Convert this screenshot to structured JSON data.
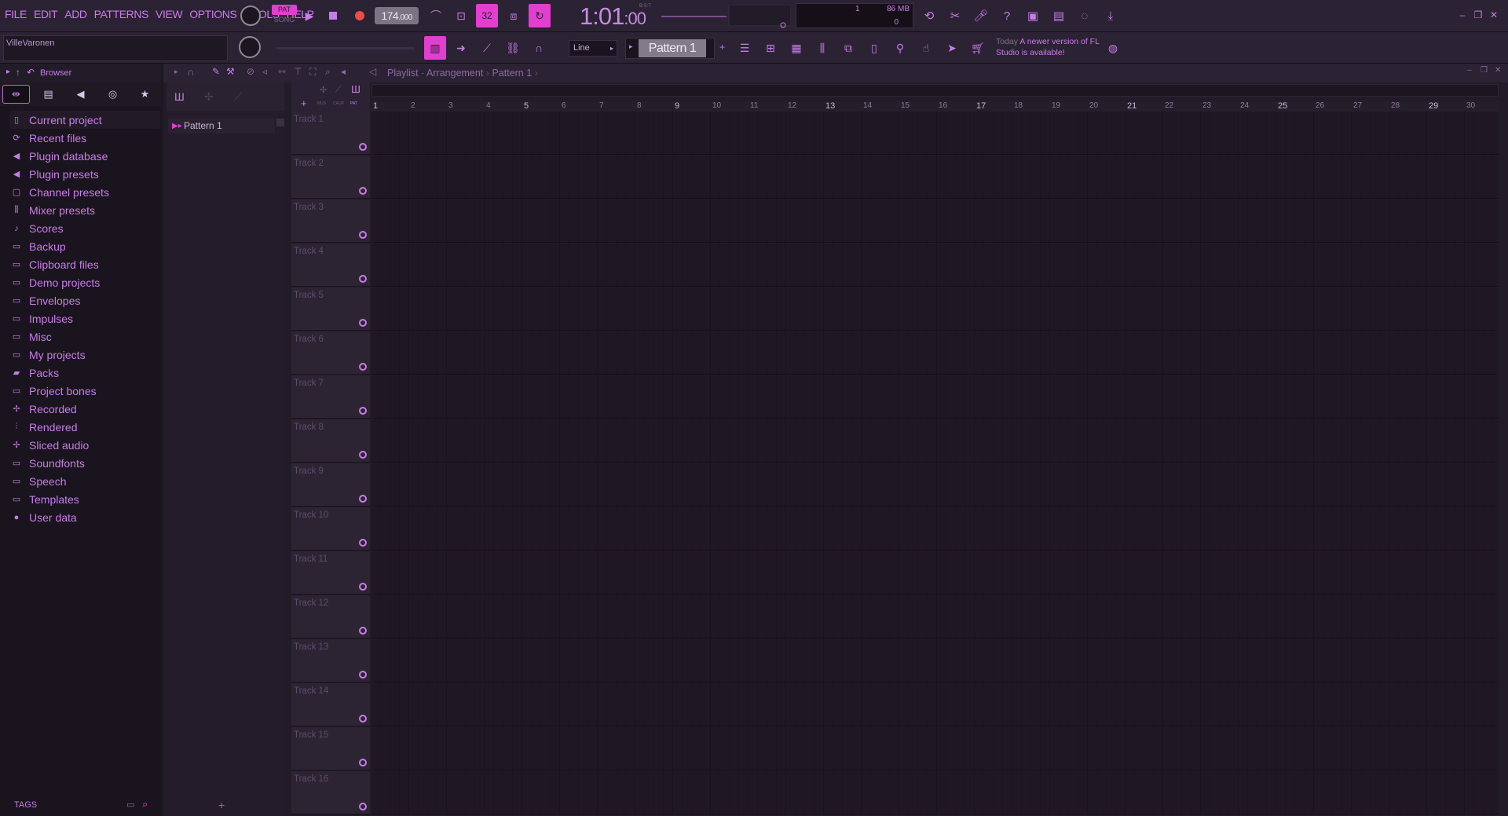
{
  "menu": [
    "FILE",
    "EDIT",
    "ADD",
    "PATTERNS",
    "VIEW",
    "OPTIONS",
    "TOOLS",
    "HELP"
  ],
  "transport": {
    "pat_label": "PAT",
    "song_label": "SONG",
    "tempo": "174",
    "tempo_decimal": ".000",
    "time_main": "1:01",
    "time_small": ":00",
    "time_sub": "B:S:T",
    "step": "32"
  },
  "monitor": {
    "memory": "86 MB",
    "polyphony": "1",
    "cpu": "0"
  },
  "toolbar2": {
    "user": "VilleVaronen",
    "snap": "Line",
    "pattern": "Pattern 1",
    "hint_today": "Today",
    "hint_text": "A newer version of FL Studio is available!"
  },
  "browser": {
    "title": "Browser",
    "items": [
      {
        "label": "Current project",
        "icon": "project-icon"
      },
      {
        "label": "Recent files",
        "icon": "recent-icon"
      },
      {
        "label": "Plugin database",
        "icon": "plugin-icon"
      },
      {
        "label": "Plugin presets",
        "icon": "plugin-icon"
      },
      {
        "label": "Channel presets",
        "icon": "channel-icon"
      },
      {
        "label": "Mixer presets",
        "icon": "mixer-icon"
      },
      {
        "label": "Scores",
        "icon": "note-icon"
      },
      {
        "label": "Backup",
        "icon": "folder-icon"
      },
      {
        "label": "Clipboard files",
        "icon": "folder-icon"
      },
      {
        "label": "Demo projects",
        "icon": "folder-icon"
      },
      {
        "label": "Envelopes",
        "icon": "folder-icon"
      },
      {
        "label": "Impulses",
        "icon": "folder-icon"
      },
      {
        "label": "Misc",
        "icon": "folder-icon"
      },
      {
        "label": "My projects",
        "icon": "folder-icon"
      },
      {
        "label": "Packs",
        "icon": "packs-icon"
      },
      {
        "label": "Project bones",
        "icon": "folder-icon"
      },
      {
        "label": "Recorded",
        "icon": "recorded-icon"
      },
      {
        "label": "Rendered",
        "icon": "rendered-icon"
      },
      {
        "label": "Sliced audio",
        "icon": "sliced-icon"
      },
      {
        "label": "Soundfonts",
        "icon": "folder-icon"
      },
      {
        "label": "Speech",
        "icon": "folder-icon"
      },
      {
        "label": "Templates",
        "icon": "folder-icon"
      },
      {
        "label": "User data",
        "icon": "user-icon"
      }
    ],
    "tags_label": "TAGS"
  },
  "playlist": {
    "title": "Playlist",
    "view": "Arrangement",
    "pattern": "Pattern 1",
    "mode_labels": [
      "MUS",
      "CAUR",
      "PAT"
    ],
    "patterns": [
      "Pattern 1"
    ],
    "tracks": [
      "Track 1",
      "Track 2",
      "Track 3",
      "Track 4",
      "Track 5",
      "Track 6",
      "Track 7",
      "Track 8",
      "Track 9",
      "Track 10",
      "Track 11",
      "Track 12",
      "Track 13",
      "Track 14",
      "Track 15",
      "Track 16"
    ],
    "bars": [
      "1",
      "2",
      "3",
      "4",
      "5",
      "6",
      "7",
      "8",
      "9",
      "10",
      "11",
      "12",
      "13",
      "14",
      "15",
      "16",
      "17",
      "18",
      "19",
      "20",
      "21",
      "22",
      "23",
      "24",
      "25",
      "26",
      "27",
      "28",
      "29",
      "30"
    ]
  },
  "colors": {
    "accent": "#e23ecf",
    "text": "#c87de8",
    "background": "#1d1623"
  }
}
